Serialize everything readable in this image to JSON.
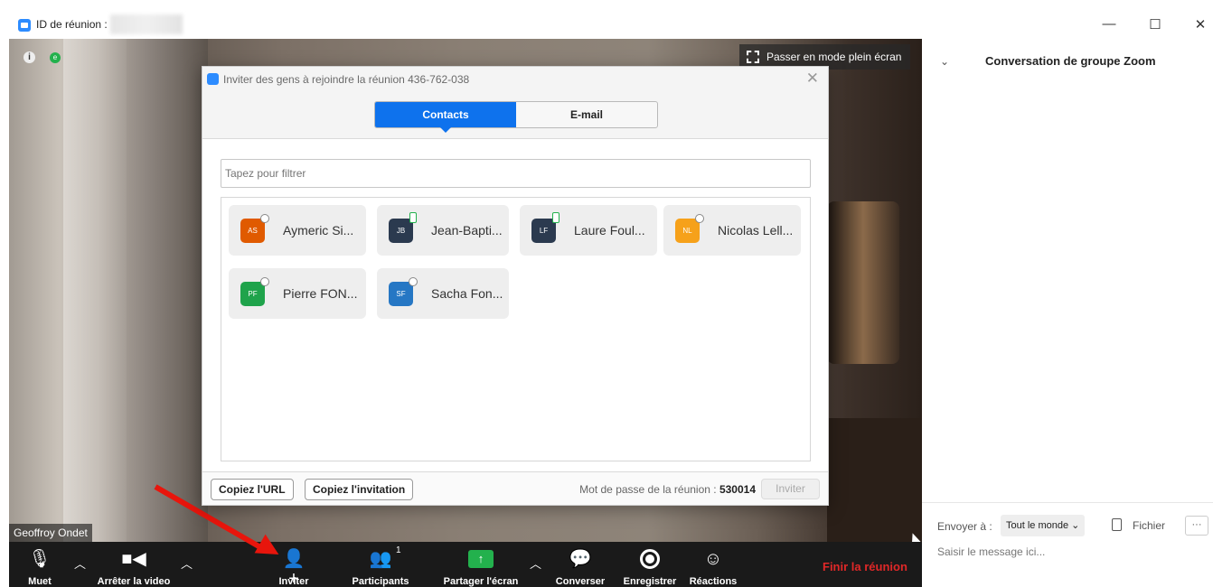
{
  "titlebar": {
    "title": "ID de réunion :",
    "minimize": "—",
    "maximize": "☐",
    "close": "✕"
  },
  "video": {
    "fullscreen_label": "Passer en mode plein écran",
    "participant_name": "Geoffroy Ondet",
    "info_icon": "i",
    "encryption_icon": "e"
  },
  "toolbar": {
    "mute_label": "Muet",
    "video_label": "Arrêter la video",
    "invite_label": "Inviter",
    "participants_label": "Participants",
    "participants_count": "1",
    "share_label": "Partager l'écran",
    "chat_label": "Converser",
    "record_label": "Enregistrer",
    "reactions_label": "Réactions",
    "end_label": "Finir la réunion"
  },
  "dialog": {
    "title": "Inviter des gens à rejoindre la réunion 436-762-038",
    "tabs": [
      "Contacts",
      "E-mail"
    ],
    "active_tab": "Contacts",
    "filter_placeholder": "Tapez pour filtrer",
    "contacts": [
      {
        "initials": "AS",
        "name": "Aymeric Si...",
        "color": "#e05a00",
        "status": "offline"
      },
      {
        "initials": "JB",
        "name": "Jean-Bapti...",
        "color": "#2b3a4f",
        "status": "online"
      },
      {
        "initials": "LF",
        "name": "Laure Foul...",
        "color": "#2b3a4f",
        "status": "online"
      },
      {
        "initials": "NL",
        "name": "Nicolas Lell...",
        "color": "#f6a11a",
        "status": "offline"
      },
      {
        "initials": "PF",
        "name": "Pierre FON...",
        "color": "#1fa34b",
        "status": "offline"
      },
      {
        "initials": "SF",
        "name": "Sacha Fon...",
        "color": "#2677c4",
        "status": "offline"
      }
    ],
    "copy_url_label": "Copiez l'URL",
    "copy_invitation_label": "Copiez l'invitation",
    "password_label": "Mot de passe de la réunion :",
    "password_value": "530014",
    "invite_button_label": "Inviter"
  },
  "chat": {
    "title": "Conversation de groupe Zoom",
    "send_to_label": "Envoyer à :",
    "send_to_value": "Tout le monde",
    "file_label": "Fichier",
    "more_label": "···",
    "message_placeholder": "Saisir le message ici..."
  },
  "colors": {
    "accent": "#0e72ed",
    "end_meeting": "#e02828",
    "share_green": "#23b14d",
    "annotation_arrow": "#e8150c"
  }
}
